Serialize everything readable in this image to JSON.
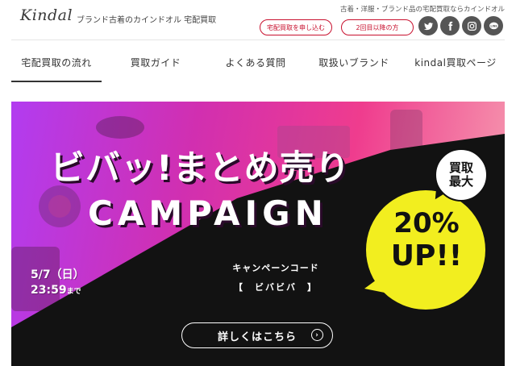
{
  "header": {
    "logo": "Kindal",
    "tagline": "ブランド古着のカインドオル 宅配買取",
    "subtitle": "古着・洋服・ブランド品の宅配買取ならカインドオル",
    "apply_button": "宅配買取を申し込む",
    "repeat_button": "2回目以降の方",
    "social": [
      "twitter-icon",
      "facebook-icon",
      "instagram-icon",
      "line-icon"
    ],
    "social_labels": {
      "line": "LINE"
    }
  },
  "nav": {
    "items": [
      {
        "label": "宅配買取の流れ",
        "active": true
      },
      {
        "label": "買取ガイド"
      },
      {
        "label": "よくある質問"
      },
      {
        "label": "取扱いブランド"
      },
      {
        "label": "kindal買取ページ"
      }
    ]
  },
  "banner": {
    "title_line1": "ビバッ!まとめ売り",
    "title_line2": "CAMPAIGN",
    "bubble_label_line1": "買取",
    "bubble_label_line2": "最大",
    "percent": "20%",
    "up": "UP!!",
    "code_label": "キャンペーンコード",
    "code_value": "【　ビバビバ　】",
    "date_line1": "5/7（日）",
    "date_line2": "23:59",
    "date_suffix": "まで",
    "cta": "詳しくはこちら",
    "cta_arrow": "›"
  },
  "colors": {
    "accent": "#c8102e",
    "banner_gradient_start": "#b23cf0",
    "banner_gradient_end": "#f6a3b2",
    "bubble": "#f2ee1f"
  }
}
